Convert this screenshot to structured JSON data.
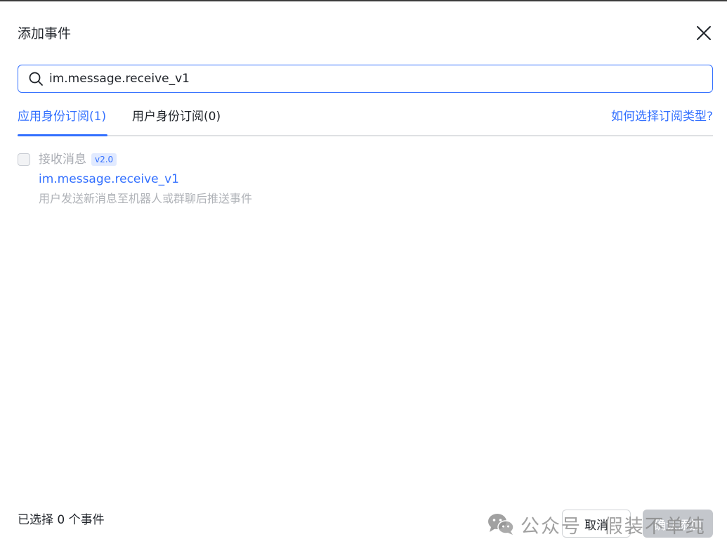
{
  "dialog": {
    "title": "添加事件"
  },
  "search": {
    "value": "im.message.receive_v1"
  },
  "tabs": [
    {
      "label": "应用身份订阅(1)"
    },
    {
      "label": "用户身份订阅(0)"
    }
  ],
  "help_link": "如何选择订阅类型?",
  "event": {
    "name": "接收消息",
    "version": "v2.0",
    "key": "im.message.receive_v1",
    "description": "用户发送新消息至机器人或群聊后推送事件"
  },
  "footer": {
    "selected_text": "已选择 0 个事件",
    "cancel_label": "取消",
    "confirm_label": "确认添加"
  },
  "watermark": {
    "text": "公众号 · 假装不单纯"
  },
  "colors": {
    "accent": "#3370ff",
    "disabled_button": "#c4c7cc",
    "muted_text": "#b0b3b8"
  },
  "icons": {
    "close": "close-icon",
    "search": "search-icon",
    "watermark": "wechat-icon"
  }
}
